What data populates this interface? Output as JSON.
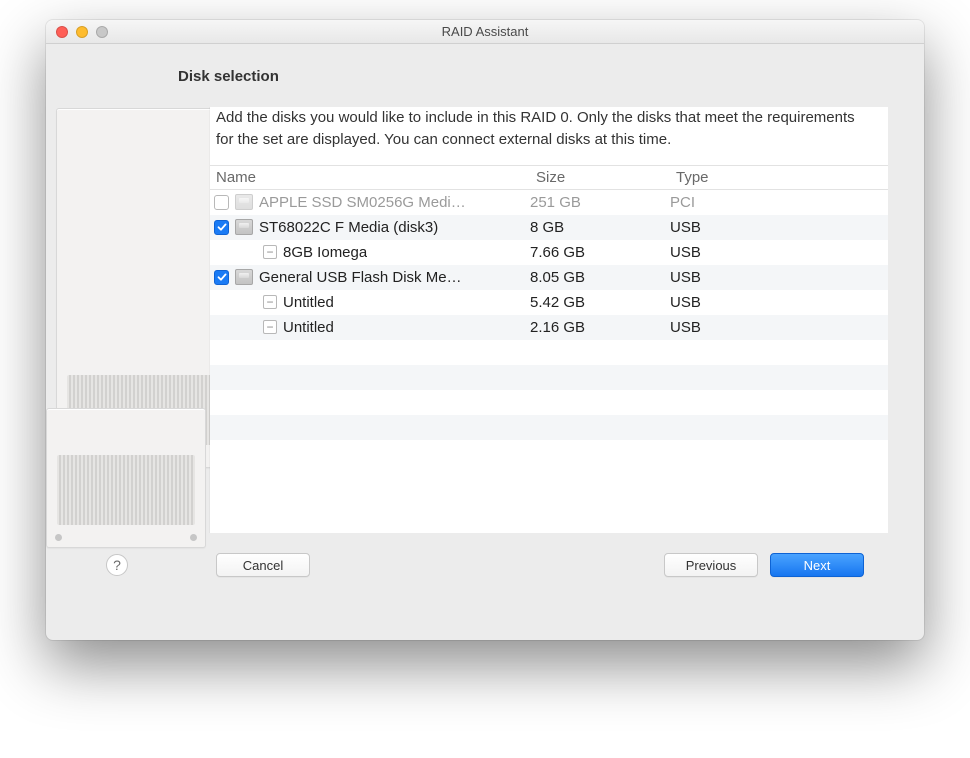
{
  "window": {
    "title": "RAID Assistant"
  },
  "heading": "Disk selection",
  "instructions": "Add the disks you would like to include in this RAID 0. Only the disks that meet the requirements for the set are displayed. You can connect external disks at this time.",
  "columns": {
    "name": "Name",
    "size": "Size",
    "type": "Type"
  },
  "rows": [
    {
      "kind": "disk",
      "checked": false,
      "dim": true,
      "name": "APPLE SSD SM0256G Medi…",
      "size": "251 GB",
      "type": "PCI"
    },
    {
      "kind": "disk",
      "checked": true,
      "dim": false,
      "name": "ST68022C F Media (disk3)",
      "size": "8 GB",
      "type": "USB"
    },
    {
      "kind": "volume",
      "checked": null,
      "dim": false,
      "name": "8GB Iomega",
      "size": "7.66 GB",
      "type": "USB"
    },
    {
      "kind": "disk",
      "checked": true,
      "dim": false,
      "name": "General USB Flash Disk Me…",
      "size": "8.05 GB",
      "type": "USB"
    },
    {
      "kind": "volume",
      "checked": null,
      "dim": false,
      "name": "Untitled",
      "size": "5.42 GB",
      "type": "USB"
    },
    {
      "kind": "volume",
      "checked": null,
      "dim": false,
      "name": "Untitled",
      "size": "2.16 GB",
      "type": "USB"
    }
  ],
  "buttons": {
    "help": "?",
    "cancel": "Cancel",
    "previous": "Previous",
    "next": "Next"
  }
}
